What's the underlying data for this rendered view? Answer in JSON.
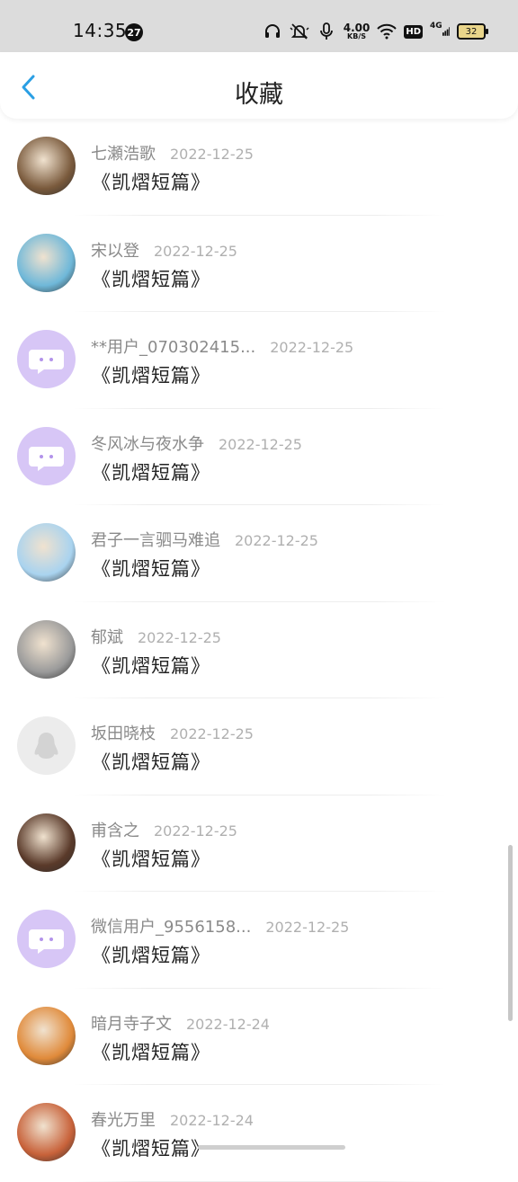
{
  "status_bar": {
    "time": "14:35",
    "notification_count": "27",
    "net_speed_value": "4.00",
    "net_speed_unit": "KB/S",
    "hd_label": "HD",
    "network_label": "4G",
    "battery_level": "32"
  },
  "header": {
    "title": "收藏"
  },
  "items": [
    {
      "name": "七瀬浩歌",
      "date": "2022-12-25",
      "work": "《凯熠短篇》",
      "avatar": "pocket-watch-photo",
      "avatar_color": "#7a5a3c"
    },
    {
      "name": "宋以登",
      "date": "2022-12-25",
      "work": "《凯熠短篇》",
      "avatar": "costume-portrait-photo",
      "avatar_color": "#6fb8d9"
    },
    {
      "name": "**用户_070302415...",
      "date": "2022-12-25",
      "work": "《凯熠短篇》",
      "avatar": "default-chat-avatar",
      "avatar_color": "#d7c6f6"
    },
    {
      "name": "冬风冰与夜水争",
      "date": "2022-12-25",
      "work": "《凯熠短篇》",
      "avatar": "default-chat-avatar",
      "avatar_color": "#d7c6f6"
    },
    {
      "name": "君子一言驷马难追",
      "date": "2022-12-25",
      "work": "《凯熠短篇》",
      "avatar": "anime-character-avatar",
      "avatar_color": "#a9d3ef"
    },
    {
      "name": "郁斌",
      "date": "2022-12-25",
      "work": "《凯熠短篇》",
      "avatar": "bw-portrait-photo",
      "avatar_color": "#9a9a9a"
    },
    {
      "name": "坂田晓枝",
      "date": "2022-12-25",
      "work": "《凯熠短篇》",
      "avatar": "default-penguin-avatar",
      "avatar_color": "#ededed"
    },
    {
      "name": "甫含之",
      "date": "2022-12-25",
      "work": "《凯熠短篇》",
      "avatar": "person-photo",
      "avatar_color": "#5a3a2a"
    },
    {
      "name": "微信用户_9556158...",
      "date": "2022-12-25",
      "work": "《凯熠短篇》",
      "avatar": "default-chat-avatar",
      "avatar_color": "#d7c6f6"
    },
    {
      "name": "暗月寺子文",
      "date": "2022-12-24",
      "work": "《凯熠短篇》",
      "avatar": "sunset-figure-photo",
      "avatar_color": "#e08a3a"
    },
    {
      "name": "春光万里",
      "date": "2022-12-24",
      "work": "《凯熠短篇》",
      "avatar": "warm-portrait-photo",
      "avatar_color": "#c8623a"
    }
  ]
}
